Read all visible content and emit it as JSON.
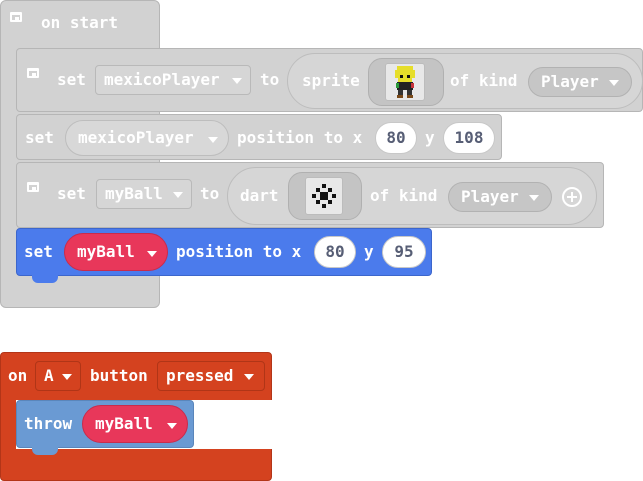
{
  "colors": {
    "disabled_block": "#d2d2d2",
    "sprites_blue": "#4b7bec",
    "variable_red": "#e8375a",
    "event_orange": "#d4421f",
    "action_blue": "#6a9ad3"
  },
  "on_start": {
    "label": "on start",
    "icon": "collapse-icon",
    "set_player": {
      "set": "set",
      "variable": "mexicoPlayer",
      "to": "to",
      "sprite": "sprite",
      "of_kind": "of kind",
      "kind": "Player"
    },
    "set_player_position": {
      "set": "set",
      "variable": "mexicoPlayer",
      "position_to_x": "position to x",
      "x": "80",
      "y_label": "y",
      "y": "108"
    },
    "set_ball": {
      "set": "set",
      "variable": "myBall",
      "to": "to",
      "dart": "dart",
      "of_kind": "of kind",
      "kind": "Player",
      "add_icon": "plus-circle-icon"
    },
    "set_ball_position": {
      "set": "set",
      "variable": "myBall",
      "position_to_x": "position to x",
      "x": "80",
      "y_label": "y",
      "y": "95"
    }
  },
  "on_button": {
    "on": "on",
    "button": "A",
    "button_label": "button",
    "event": "pressed",
    "throw": {
      "label": "throw",
      "variable": "myBall"
    }
  }
}
